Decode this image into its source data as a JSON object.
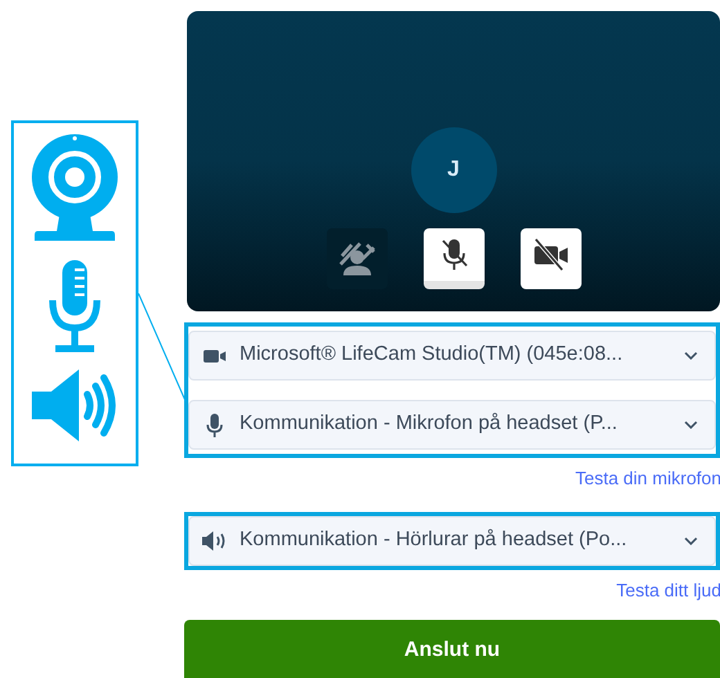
{
  "video_preview": {
    "avatar_initial": "J",
    "controls": [
      {
        "kind": "background_effects",
        "enabled": false
      },
      {
        "kind": "microphone",
        "enabled": false
      },
      {
        "kind": "camera",
        "enabled": false
      }
    ]
  },
  "device_groups": [
    {
      "devices": [
        {
          "kind": "camera",
          "value": "Microsoft® LifeCam Studio(TM) (045e:08..."
        },
        {
          "kind": "microphone",
          "value": "Kommunikation - Mikrofon på headset (P..."
        }
      ],
      "test_link": "Testa din mikrofon"
    },
    {
      "devices": [
        {
          "kind": "speaker",
          "value": "Kommunikation - Hörlurar på headset (Po..."
        }
      ],
      "test_link": "Testa ditt ljud"
    }
  ],
  "join_button": "Anslut nu"
}
